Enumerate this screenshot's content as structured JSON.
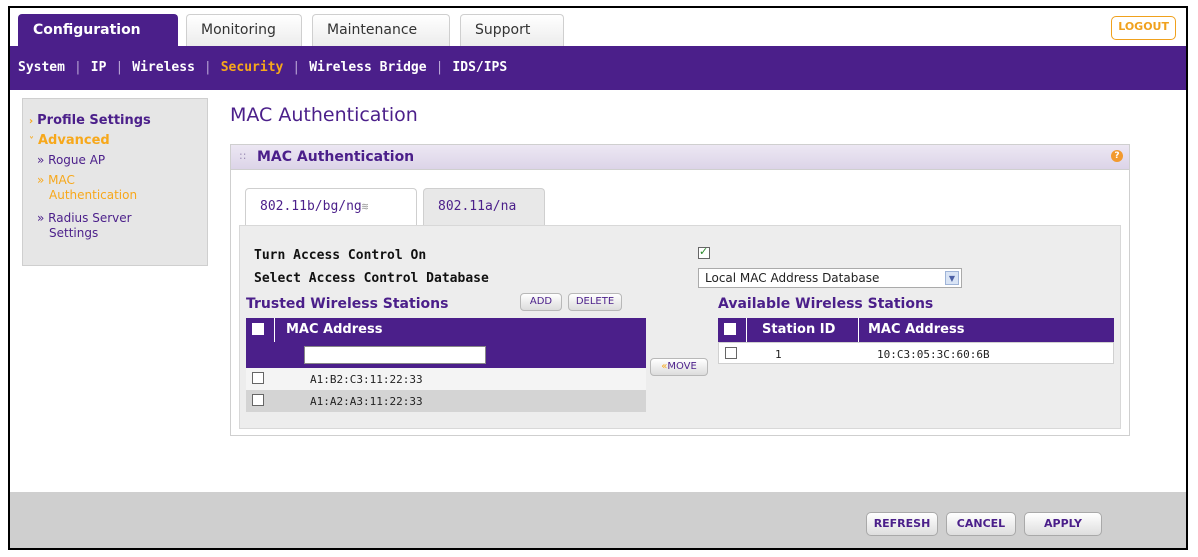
{
  "tabs": [
    {
      "label": "Configuration"
    },
    {
      "label": "Monitoring"
    },
    {
      "label": "Maintenance"
    },
    {
      "label": "Support"
    }
  ],
  "logout_label": "LOGOUT",
  "subnav": {
    "items": [
      "System",
      "IP",
      "Wireless",
      "Security",
      "Wireless Bridge",
      "IDS/IPS"
    ],
    "selected": "Security"
  },
  "sidebar": {
    "profile_settings": "Profile Settings",
    "advanced": "Advanced",
    "rogue_ap": "Rogue AP",
    "mac_auth_1": "MAC",
    "mac_auth_2": "Authentication",
    "radius_1": "Radius Server",
    "radius_2": "Settings"
  },
  "page_title": "MAC Authentication",
  "panel": {
    "title": "MAC Authentication",
    "help_icon": "?",
    "subtabs": [
      "802.11b/bg/ng",
      "802.11a/na"
    ],
    "turn_access_label": "Turn Access Control On",
    "turn_access_checked": true,
    "select_db_label": "Select Access Control Database",
    "select_db_value": "Local MAC Address Database"
  },
  "trusted": {
    "title": "Trusted Wireless Stations",
    "add_label": "ADD",
    "delete_label": "DELETE",
    "col_mac": "MAC Address",
    "mac_input_value": "",
    "rows": [
      "A1:B2:C3:11:22:33",
      "A1:A2:A3:11:22:33"
    ]
  },
  "move_label": "MOVE",
  "available": {
    "title": "Available Wireless Stations",
    "col_station": "Station ID",
    "col_mac": "MAC Address",
    "rows": [
      {
        "station_id": "1",
        "mac": "10:C3:05:3C:60:6B"
      }
    ]
  },
  "buttons": {
    "refresh": "REFRESH",
    "cancel": "CANCEL",
    "apply": "APPLY"
  },
  "colors": {
    "brand_purple": "#4b1f8a",
    "accent_orange": "#f7a81b"
  }
}
